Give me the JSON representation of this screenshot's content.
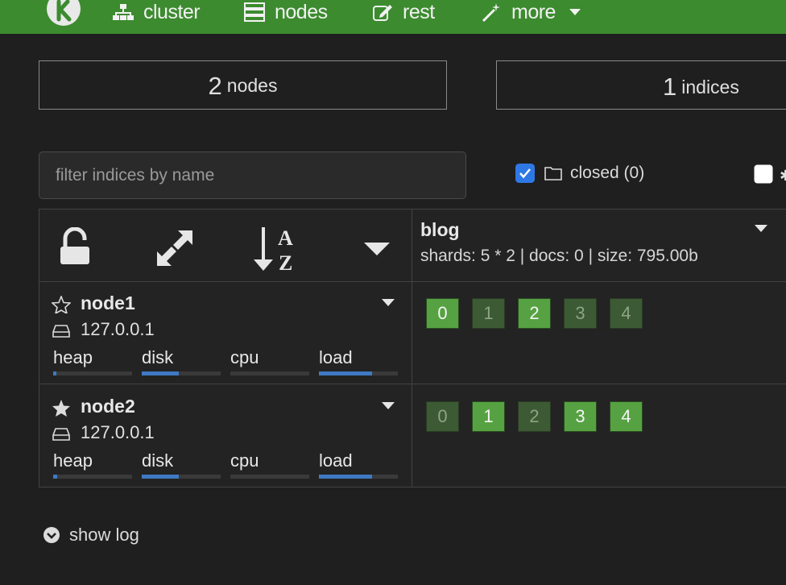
{
  "navbar": {
    "items": [
      {
        "label": "cluster",
        "icon": "sitemap-icon"
      },
      {
        "label": "nodes",
        "icon": "server-icon"
      },
      {
        "label": "rest",
        "icon": "edit-icon"
      },
      {
        "label": "more",
        "icon": "magic-wand-icon"
      }
    ]
  },
  "stats": {
    "nodes_count": "2",
    "nodes_label": "nodes",
    "indices_count": "1",
    "indices_label": "indices"
  },
  "filter": {
    "placeholder": "filter indices by name",
    "value": ""
  },
  "options": {
    "closed_label": "closed (0)",
    "closed_checked": true,
    "special_checked": false
  },
  "index": {
    "name": "blog",
    "info": "shards: 5 * 2 | docs: 0 | size: 795.00b"
  },
  "metrics_labels": [
    "heap",
    "disk",
    "cpu",
    "load"
  ],
  "nodes": [
    {
      "name": "node1",
      "ip": "127.0.0.1",
      "master": false,
      "metric_fill": [
        0.04,
        0.47,
        0.0,
        0.67
      ],
      "shards": [
        {
          "num": "0",
          "primary": true
        },
        {
          "num": "1",
          "primary": false
        },
        {
          "num": "2",
          "primary": true
        },
        {
          "num": "3",
          "primary": false
        },
        {
          "num": "4",
          "primary": false
        }
      ]
    },
    {
      "name": "node2",
      "ip": "127.0.0.1",
      "master": true,
      "metric_fill": [
        0.05,
        0.47,
        0.0,
        0.67
      ],
      "shards": [
        {
          "num": "0",
          "primary": false
        },
        {
          "num": "1",
          "primary": true
        },
        {
          "num": "2",
          "primary": false
        },
        {
          "num": "3",
          "primary": true
        },
        {
          "num": "4",
          "primary": true
        }
      ]
    }
  ],
  "footer": {
    "show_log_label": "show log"
  },
  "colors": {
    "navbar": "#3c8b2f",
    "background": "#1f1f1f",
    "primary_shard": "#56a242",
    "replica_shard": "#3c5a34",
    "bar_fill": "#3f79c2"
  }
}
